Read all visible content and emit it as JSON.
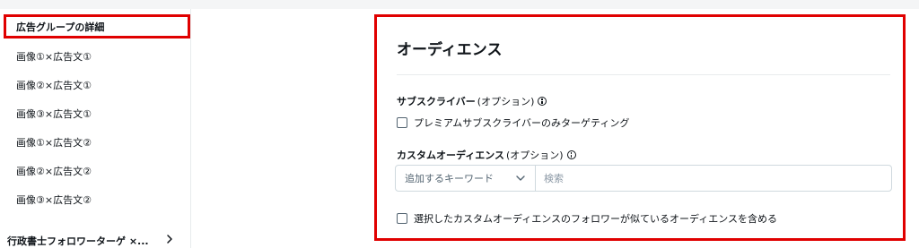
{
  "sidebar": {
    "active_item": "広告グループの詳細",
    "items": [
      "画像①×広告文①",
      "画像②×広告文①",
      "画像③×広告文①",
      "画像①×広告文②",
      "画像②×広告文②",
      "画像③×広告文②"
    ],
    "footer_label": "行政書士フォロワーターゲ ×..."
  },
  "panel": {
    "title": "オーディエンス",
    "subscriber_label": "サブスクライバー",
    "subscriber_optional": "(オプション)",
    "subscriber_checkbox": "プレミアムサブスクライバーのみターゲティング",
    "custom_label": "カスタムオーディエンス",
    "custom_optional": "(オプション)",
    "select_value": "追加するキーワード",
    "search_placeholder": "検索",
    "follower_checkbox": "選択したカスタムオーディエンスのフォロワーが似ているオーディエンスを含める"
  },
  "colors": {
    "highlight": "#e00000",
    "text": "#0f1419",
    "muted": "#536471"
  }
}
